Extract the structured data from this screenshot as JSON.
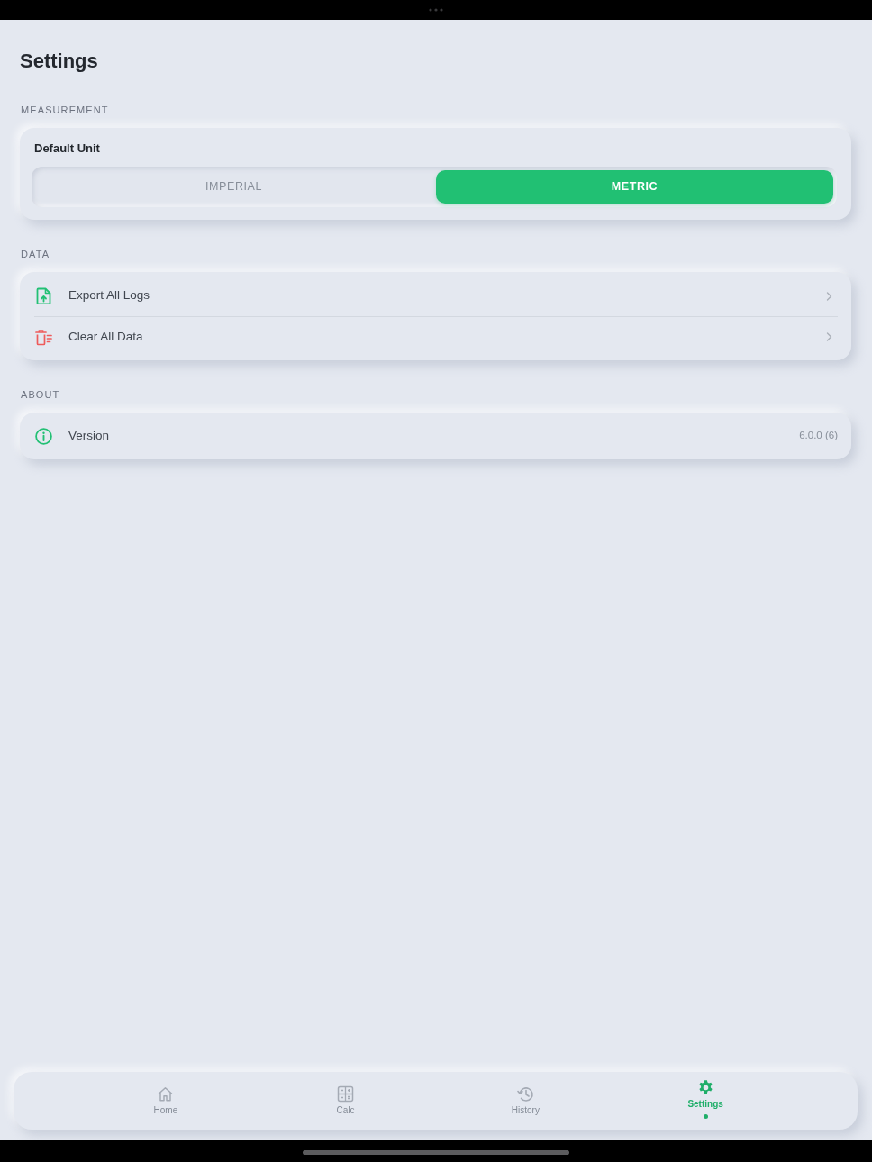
{
  "title": "Settings",
  "sections": [
    {
      "heading": "MEASUREMENT",
      "kind": "segmented",
      "label": "Default Unit",
      "options": [
        {
          "label": "IMPERIAL",
          "selected": false
        },
        {
          "label": "METRIC",
          "selected": true
        }
      ]
    },
    {
      "heading": "DATA",
      "kind": "list",
      "rows": [
        {
          "kind": "export",
          "label": "Export All Logs"
        },
        {
          "kind": "clear",
          "label": "Clear All Data"
        }
      ]
    },
    {
      "heading": "ABOUT",
      "kind": "list",
      "rows": [
        {
          "kind": "version",
          "label": "Version",
          "value": "6.0.0 (6)"
        }
      ]
    }
  ],
  "tabs": [
    {
      "kind": "home",
      "label": "Home",
      "selected": false
    },
    {
      "kind": "calc",
      "label": "Calc",
      "selected": false
    },
    {
      "kind": "history",
      "label": "History",
      "selected": false
    },
    {
      "kind": "settings",
      "label": "Settings",
      "selected": true
    }
  ]
}
